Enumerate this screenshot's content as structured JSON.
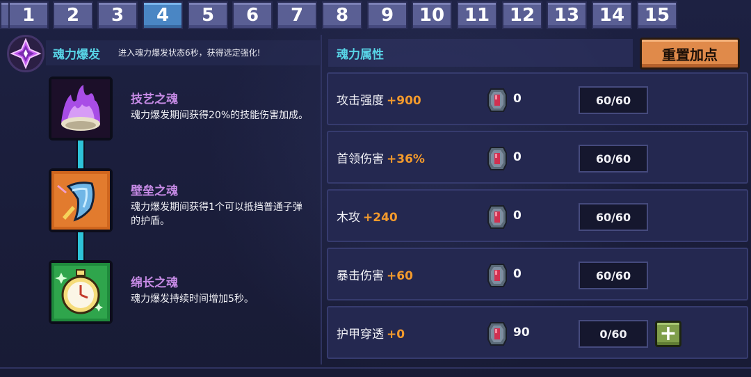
{
  "tabs": [
    {
      "label": "1",
      "active": false
    },
    {
      "label": "2",
      "active": false
    },
    {
      "label": "3",
      "active": false
    },
    {
      "label": "4",
      "active": true
    },
    {
      "label": "5",
      "active": false
    },
    {
      "label": "6",
      "active": false
    },
    {
      "label": "7",
      "active": false
    },
    {
      "label": "8",
      "active": false
    },
    {
      "label": "9",
      "active": false
    },
    {
      "label": "10",
      "active": false
    },
    {
      "label": "11",
      "active": false
    },
    {
      "label": "12",
      "active": false
    },
    {
      "label": "13",
      "active": false
    },
    {
      "label": "14",
      "active": false
    },
    {
      "label": "15",
      "active": false
    }
  ],
  "burst": {
    "title": "魂力爆发",
    "subtitle": "进入魂力爆发状态6秒，获得选定强化!"
  },
  "skills": [
    {
      "name": "技艺之魂",
      "desc": "魂力爆发期间获得20%的技能伤害加成。",
      "icon": "purple-flame-icon"
    },
    {
      "name": "壁垒之魂",
      "desc": "魂力爆发期间获得1个可以抵挡普通子弹的护盾。",
      "icon": "shield-icon"
    },
    {
      "name": "绵长之魂",
      "desc": "魂力爆发持续时间增加5秒。",
      "icon": "pocket-watch-icon"
    }
  ],
  "attributes": {
    "title": "魂力属性",
    "reset_label": "重置加点",
    "rows": [
      {
        "label": "攻击强度",
        "bonus": "+900",
        "gems": "0",
        "progress": "60/60",
        "can_add": false
      },
      {
        "label": "首领伤害",
        "bonus": "+36%",
        "gems": "0",
        "progress": "60/60",
        "can_add": false
      },
      {
        "label": "木攻",
        "bonus": "+240",
        "gems": "0",
        "progress": "60/60",
        "can_add": false
      },
      {
        "label": "暴击伤害",
        "bonus": "+60",
        "gems": "0",
        "progress": "60/60",
        "can_add": false
      },
      {
        "label": "护甲穿透",
        "bonus": "+0",
        "gems": "90",
        "progress": "0/60",
        "can_add": true
      }
    ],
    "plus_label": "+"
  },
  "colors": {
    "accent_cyan": "#58d4e6",
    "bonus_orange": "#f39a2c",
    "skill_name_purple": "#c78be6",
    "reset_orange": "#e08a4a",
    "plus_green": "#7f9e4b",
    "active_tab_blue": "#4a86c4"
  }
}
